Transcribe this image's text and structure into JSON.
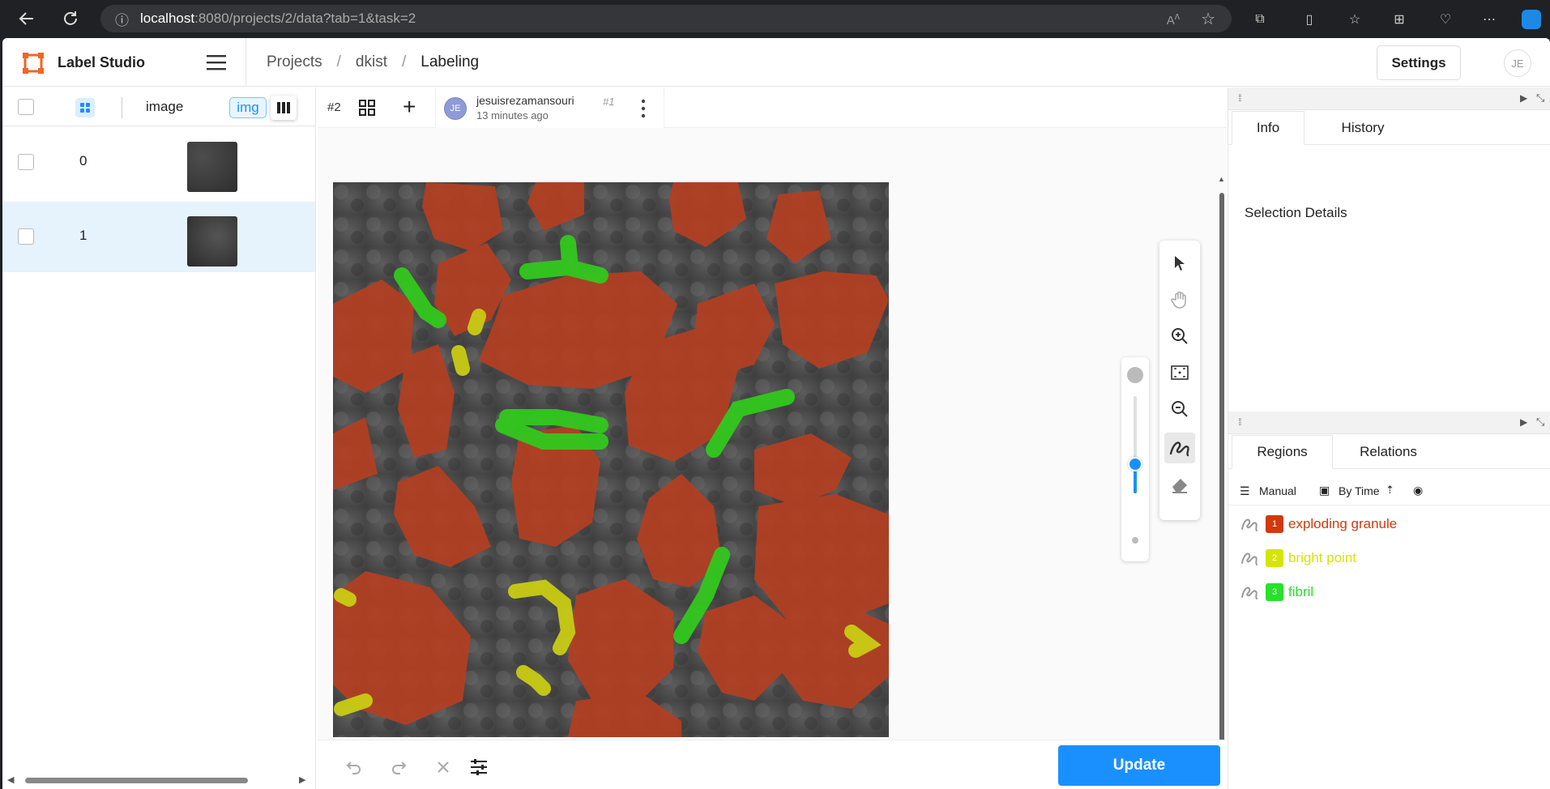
{
  "browser": {
    "url_host": "localhost",
    "url_path": ":8080/projects/2/data?tab=1&task=2"
  },
  "app": {
    "brand": "Label Studio",
    "breadcrumbs": [
      "Projects",
      "dkist",
      "Labeling"
    ],
    "settings_label": "Settings",
    "user_initials": "JE"
  },
  "data_table": {
    "col_image": "image",
    "col_img_badge": "img",
    "rows": [
      {
        "id": "0"
      },
      {
        "id": "1",
        "selected": true
      }
    ]
  },
  "annotation": {
    "task_number": "#2",
    "user": "jesuisrezamansouri",
    "annotation_number": "#1",
    "time": "13 minutes ago",
    "user_initials": "JE"
  },
  "labels": [
    {
      "name": "exploding granule",
      "hotkey": "1",
      "color": "#d4380d",
      "bg": "#f5d9cf"
    },
    {
      "name": "bright point",
      "hotkey": "2",
      "color": "#d4e600",
      "bg": "#f5f8cc"
    },
    {
      "name": "fibril",
      "hotkey": "3",
      "color": "#27e22a",
      "bg": "#d6f7d4"
    }
  ],
  "tools": [
    "select-icon",
    "hand-icon",
    "zoom-in-icon",
    "fit-icon",
    "zoom-out-icon",
    "brush-icon",
    "eraser-icon"
  ],
  "brush_size_level": 0.3,
  "bottom": {
    "update_label": "Update"
  },
  "right_panel": {
    "tabs_top": [
      "Info",
      "History"
    ],
    "selection_details": "Selection Details",
    "tabs_bottom": [
      "Regions",
      "Relations"
    ],
    "sort_manual": "Manual",
    "sort_by_time": "By Time",
    "regions": [
      {
        "index": "1",
        "label": "exploding granule",
        "color": "#d4380d"
      },
      {
        "index": "2",
        "label": "bright point",
        "color": "#d4e600"
      },
      {
        "index": "3",
        "label": "fibril",
        "color": "#27e22a"
      }
    ]
  }
}
